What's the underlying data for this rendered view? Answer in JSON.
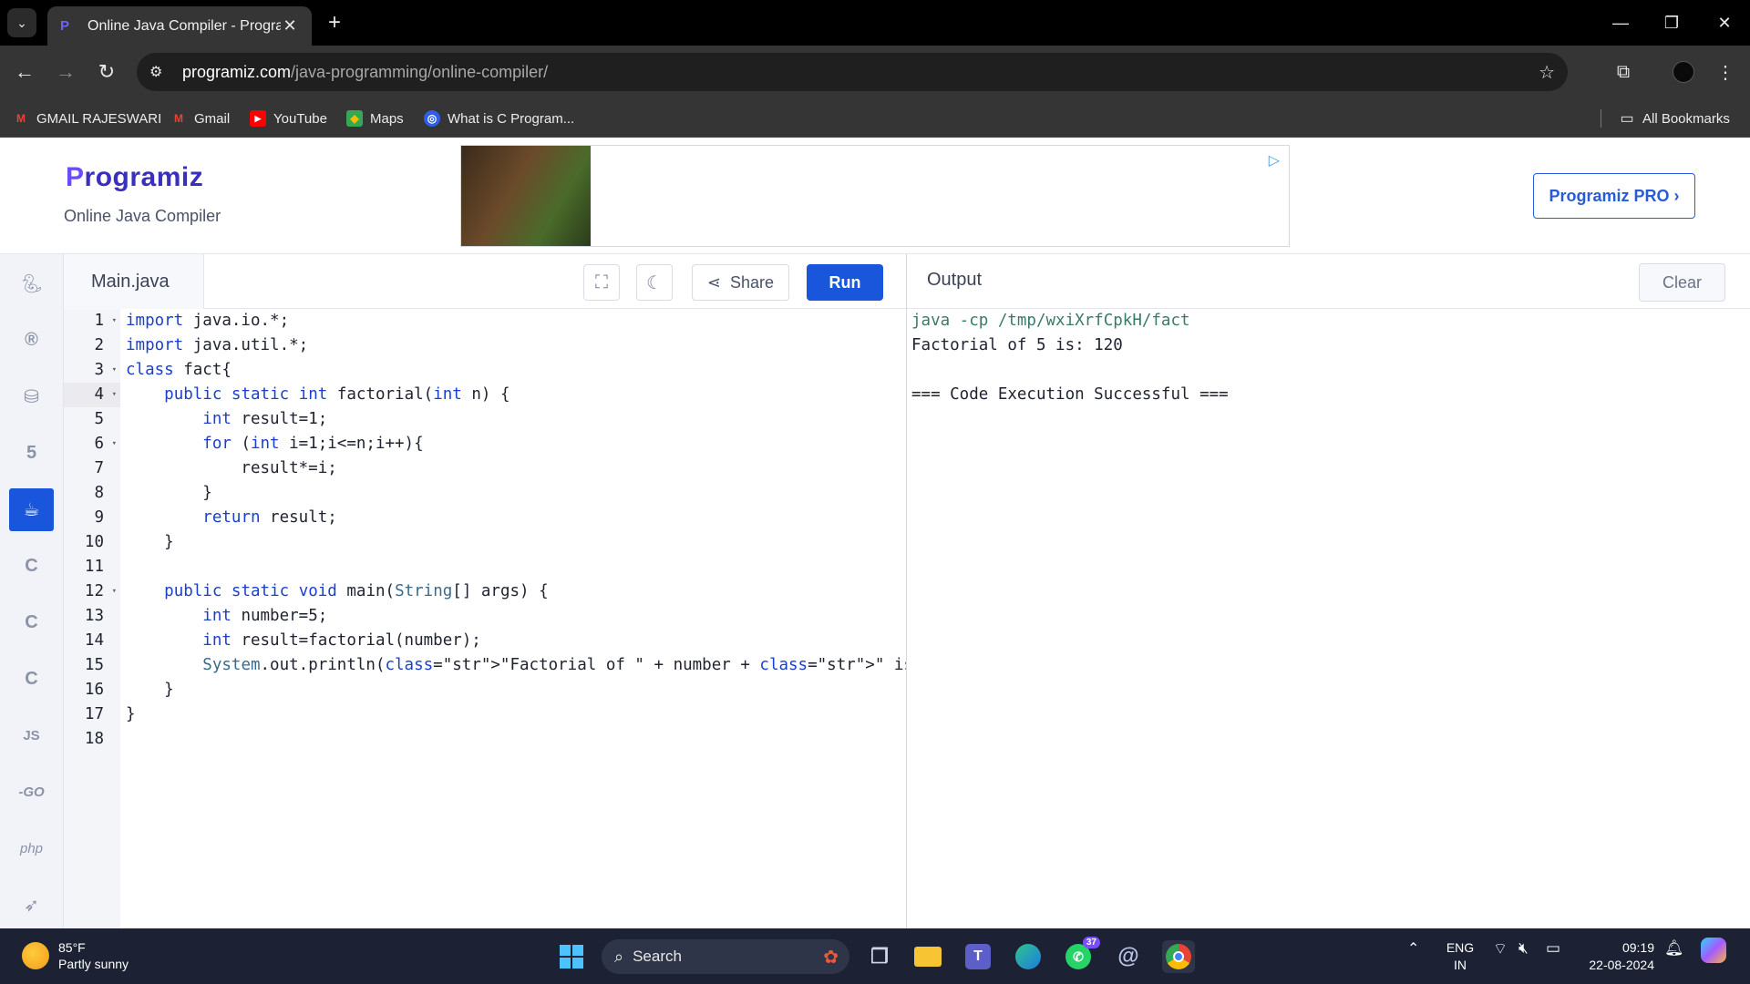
{
  "browser": {
    "tab_title": "Online Java Compiler - Program",
    "url_host": "programiz.com",
    "url_path": "/java-programming/online-compiler/",
    "bookmarks": [
      {
        "label": "GMAIL RAJESWARI"
      },
      {
        "label": "Gmail"
      },
      {
        "label": "YouTube"
      },
      {
        "label": "Maps"
      },
      {
        "label": "What is C Program..."
      }
    ],
    "all_bookmarks_label": "All Bookmarks"
  },
  "site": {
    "logo_p": "P",
    "logo_rest": "rogramiz",
    "subtitle": "Online Java Compiler",
    "pro_button": "Programiz PRO ›"
  },
  "languages": [
    {
      "icon": "python-icon"
    },
    {
      "icon": "r-icon"
    },
    {
      "icon": "database-icon"
    },
    {
      "icon": "html5-icon"
    },
    {
      "icon": "java-icon",
      "active": true
    },
    {
      "icon": "c-icon"
    },
    {
      "icon": "cpp-icon"
    },
    {
      "icon": "csharp-icon"
    },
    {
      "icon": "js-icon",
      "label": "JS"
    },
    {
      "icon": "go-icon",
      "label": "-GO"
    },
    {
      "icon": "php-icon",
      "label": "php"
    },
    {
      "icon": "swift-icon"
    }
  ],
  "editor": {
    "file_name": "Main.java",
    "share_label": "Share",
    "run_label": "Run",
    "line_numbers": [
      "1",
      "2",
      "3",
      "4",
      "5",
      "6",
      "7",
      "8",
      "9",
      "10",
      "11",
      "12",
      "13",
      "14",
      "15",
      "16",
      "17",
      "18"
    ],
    "lines": [
      "import java.io.*;",
      "import java.util.*;",
      "class fact{",
      "    public static int factorial(int n) {",
      "        int result=1;",
      "        for (int i=1;i<=n;i++){",
      "            result*=i;",
      "        }",
      "        return result;",
      "    }",
      "",
      "    public static void main(String[] args) {",
      "        int number=5;",
      "        int result=factorial(number);",
      "        System.out.println(\"Factorial of \" + number + \" is: \" + result);",
      "    }",
      "}",
      ""
    ]
  },
  "output": {
    "title": "Output",
    "clear_label": "Clear",
    "lines": [
      "java -cp /tmp/wxiXrfCpkH/fact",
      "Factorial of 5 is: 120",
      "",
      "=== Code Execution Successful ==="
    ]
  },
  "taskbar": {
    "temperature": "85°F",
    "weather": "Partly sunny",
    "search_placeholder": "Search",
    "whatsapp_badge": "37",
    "lang_top": "ENG",
    "lang_bottom": "IN",
    "time": "09:19",
    "date": "22-08-2024"
  }
}
